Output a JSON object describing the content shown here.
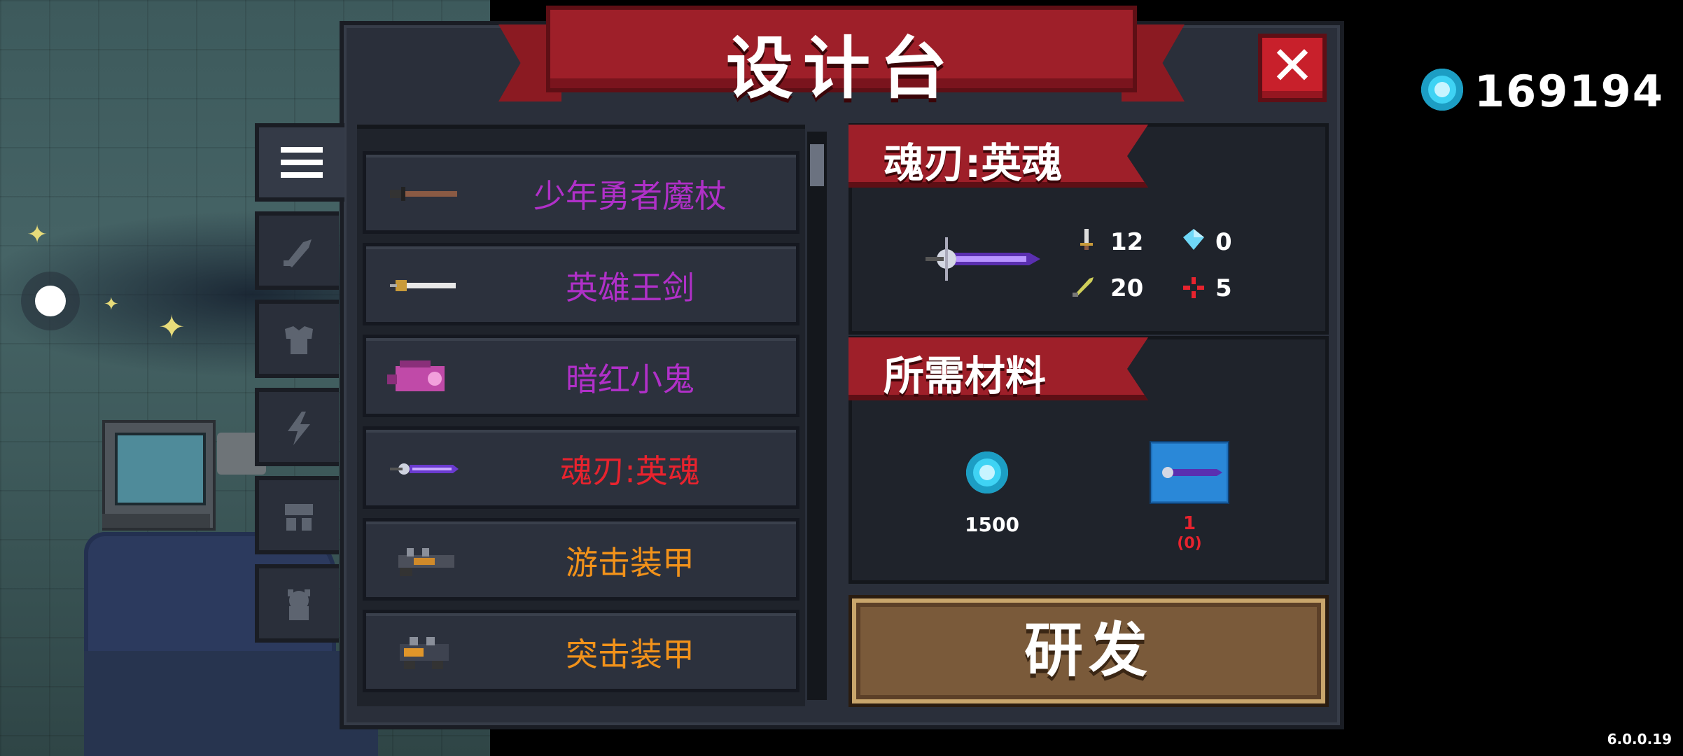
{
  "title": "设计台",
  "close_label": "✕",
  "currency": {
    "icon": "gem-icon",
    "value": "169194"
  },
  "tabs": [
    {
      "name": "list-icon",
      "active": true
    },
    {
      "name": "weapon-icon",
      "active": false
    },
    {
      "name": "armor-icon",
      "active": false
    },
    {
      "name": "skill-icon",
      "active": false
    },
    {
      "name": "mech-icon",
      "active": false
    },
    {
      "name": "pet-icon",
      "active": false
    }
  ],
  "items": [
    {
      "label": "少年勇者魔杖",
      "color": "#b030c8",
      "icon": "staff-icon"
    },
    {
      "label": "英雄王剑",
      "color": "#b030c8",
      "icon": "sword-icon"
    },
    {
      "label": "暗红小鬼",
      "color": "#b030c8",
      "icon": "imp-icon"
    },
    {
      "label": "魂刃:英魂",
      "color": "#e8232e",
      "icon": "soul-blade-icon"
    },
    {
      "label": "游击装甲",
      "color": "#f2921a",
      "icon": "mech-armor-icon"
    },
    {
      "label": "突击装甲",
      "color": "#f2921a",
      "icon": "assault-armor-icon"
    }
  ],
  "detail": {
    "name": "魂刃:英魂",
    "stats": {
      "attack": "12",
      "energy": "0",
      "crit": "20",
      "accuracy": "5"
    }
  },
  "materials": {
    "header": "所需材料",
    "list": [
      {
        "icon": "gem-icon",
        "amount": "1500",
        "color": "#ffffff"
      },
      {
        "icon": "blueprint-icon",
        "amount": "1",
        "owned": "(0)",
        "color": "#e8232e"
      }
    ]
  },
  "research_label": "研发",
  "version": "6.0.0.19",
  "colors": {
    "accent_red": "#9e1f29",
    "gem": "#3fd3f4",
    "button": "#7a5a3a"
  }
}
